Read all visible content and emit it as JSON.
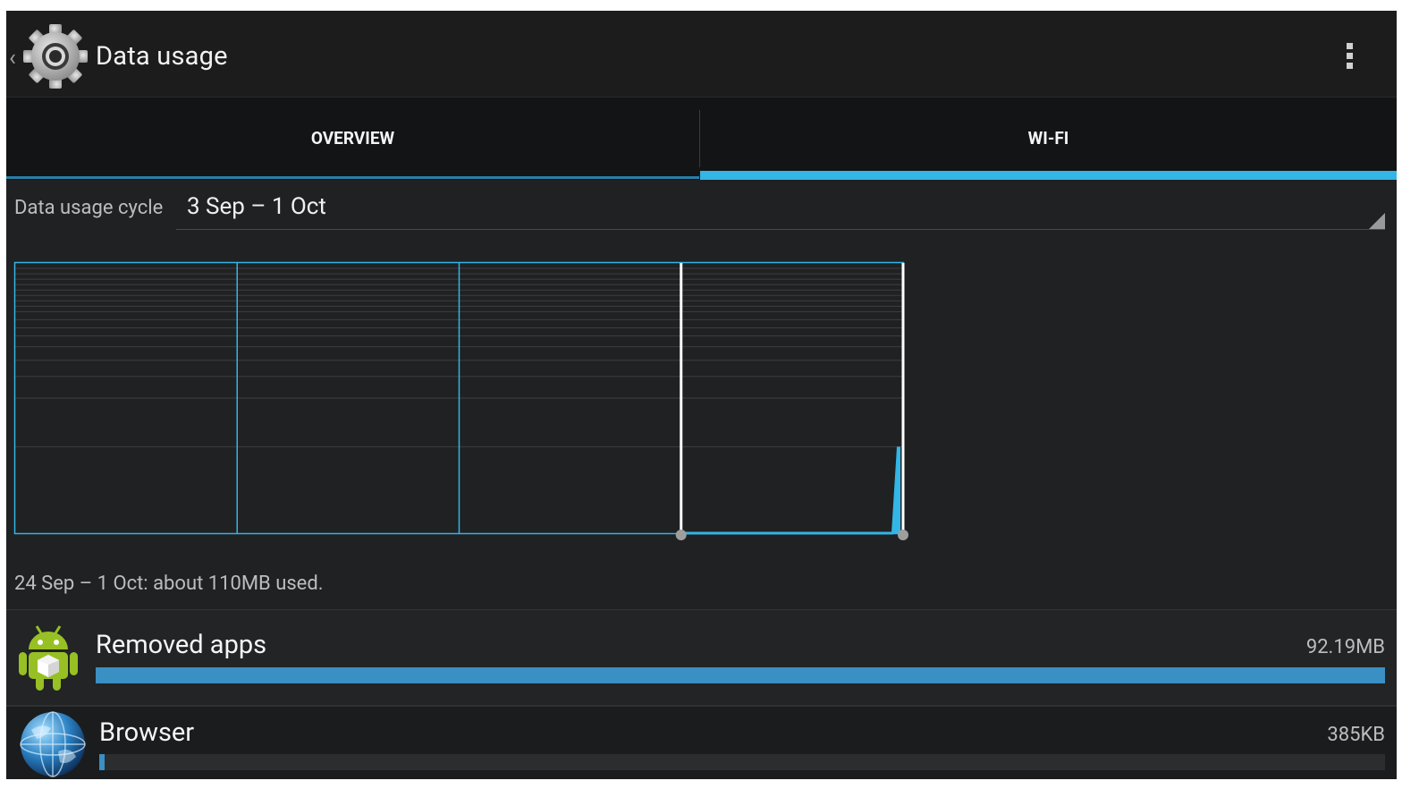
{
  "action_bar": {
    "title": "Data usage",
    "icon": "settings-gear-icon",
    "back": "chevron-left-icon",
    "overflow": "overflow-menu-icon"
  },
  "tabs": [
    {
      "label": "OVERVIEW",
      "selected": false
    },
    {
      "label": "WI-FI",
      "selected": true
    }
  ],
  "colors": {
    "accent": "#33b5e5",
    "bar_fill": "#3a8fc3",
    "background": "#1f2123"
  },
  "cycle": {
    "label": "Data usage cycle",
    "value": "3 Sep – 1 Oct"
  },
  "chart_data": {
    "type": "area",
    "x_range": [
      "3 Sep",
      "1 Oct"
    ],
    "selection": {
      "start": "24 Sep",
      "end": "1 Oct"
    },
    "spike": {
      "position": 0.997,
      "level": 0.32
    }
  },
  "summary": "24 Sep – 1 Oct: about 110MB used.",
  "apps": [
    {
      "name": "Removed apps",
      "size": "92.19MB",
      "usage_fraction": 1.0,
      "icon": "android-robot-icon"
    },
    {
      "name": "Browser",
      "size": "385KB",
      "usage_fraction": 0.004,
      "icon": "globe-icon"
    }
  ]
}
